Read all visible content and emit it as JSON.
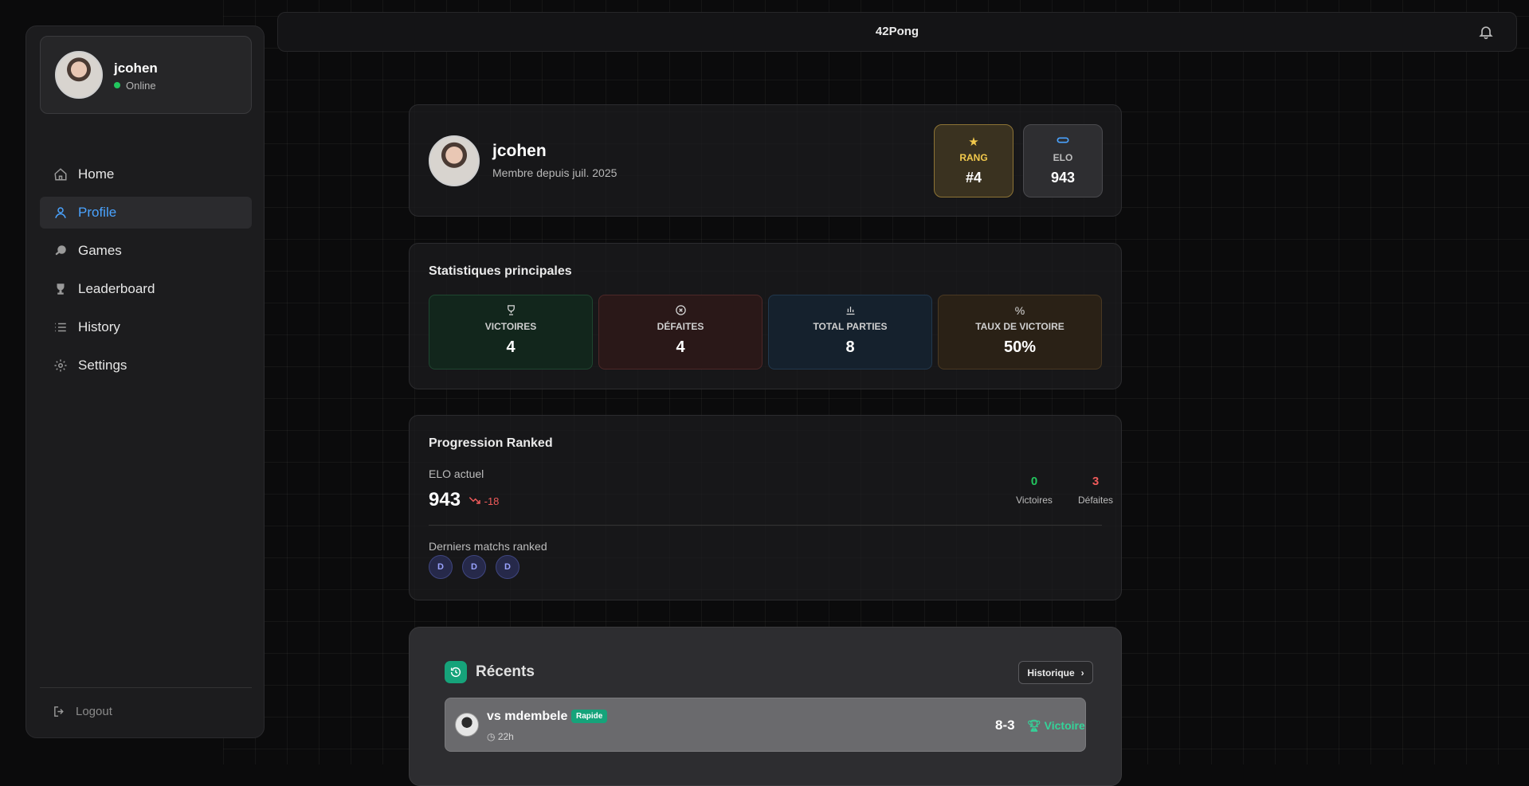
{
  "app": {
    "title": "42Pong"
  },
  "sidebar": {
    "user": {
      "name": "jcohen",
      "status": "Online"
    },
    "items": [
      {
        "label": "Home",
        "icon": "home-icon",
        "active": false
      },
      {
        "label": "Profile",
        "icon": "user-icon",
        "active": true
      },
      {
        "label": "Games",
        "icon": "ping-pong-icon",
        "active": false
      },
      {
        "label": "Leaderboard",
        "icon": "trophy-icon",
        "active": false
      },
      {
        "label": "History",
        "icon": "list-icon",
        "active": false
      },
      {
        "label": "Settings",
        "icon": "gear-icon",
        "active": false
      }
    ],
    "logout_label": "Logout"
  },
  "profile": {
    "name": "jcohen",
    "member_since": "Membre depuis juil. 2025",
    "rank": {
      "label": "RANG",
      "value": "#4"
    },
    "elo": {
      "label": "ELO",
      "value": "943"
    }
  },
  "stats": {
    "title": "Statistiques principales",
    "items": [
      {
        "label": "VICTOIRES",
        "value": "4",
        "icon": "trophy-icon"
      },
      {
        "label": "DÉFAITES",
        "value": "4",
        "icon": "x-circle-icon"
      },
      {
        "label": "TOTAL PARTIES",
        "value": "8",
        "icon": "bar-chart-icon"
      },
      {
        "label": "TAUX DE VICTOIRE",
        "value": "50%",
        "icon": "percent-icon"
      }
    ]
  },
  "ranked": {
    "title": "Progression Ranked",
    "current_label": "ELO actuel",
    "current_value": "943",
    "trend": "-18",
    "wins_value": "0",
    "wins_label": "Victoires",
    "losses_value": "3",
    "losses_label": "Défaites",
    "last_label": "Derniers matchs ranked",
    "last_results": [
      "D",
      "D",
      "D"
    ]
  },
  "recent": {
    "title": "Récents",
    "history_button": "Historique",
    "matches": [
      {
        "opponent": "vs mdembele",
        "mode": "Rapide",
        "time": "22h",
        "score": "8-3",
        "result": "Victoire"
      }
    ]
  },
  "colors": {
    "accent_blue": "#4aa3ff",
    "win_green": "#22c55e",
    "loss_red": "#ef5b5b",
    "rank_gold": "#f2c94c",
    "recent_green": "#16a37a"
  }
}
